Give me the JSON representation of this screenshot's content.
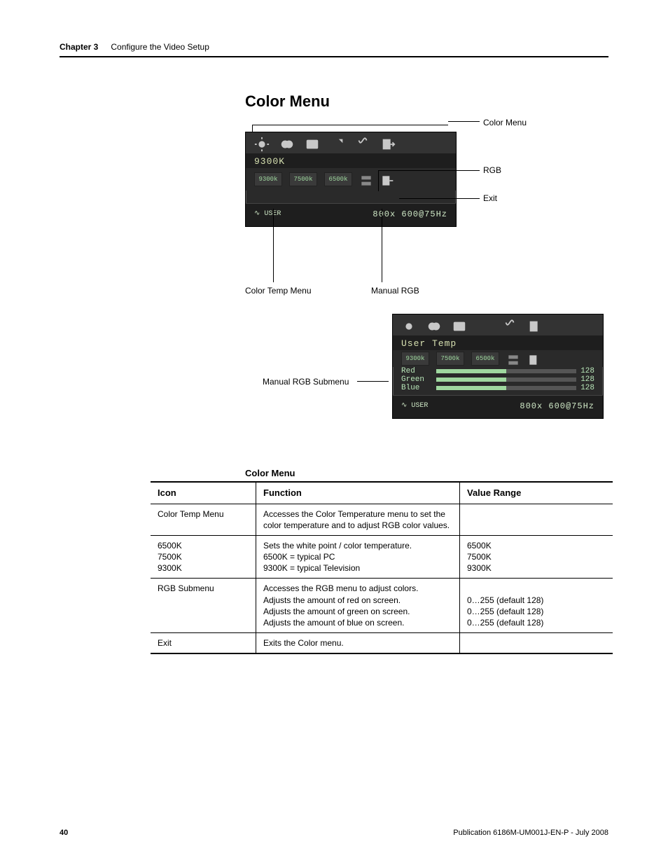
{
  "header": {
    "chapter": "Chapter 3",
    "title": "Configure the Video Setup"
  },
  "section_title": "Color Menu",
  "figure": {
    "callouts": {
      "color_menu": "Color Menu",
      "rgb": "RGB",
      "exit": "Exit",
      "color_temp_menu": "Color Temp Menu",
      "manual_rgb": "Manual RGB",
      "manual_rgb_submenu": "Manual RGB Submenu"
    },
    "osd_main": {
      "label": "9300K",
      "temps": [
        "9300k",
        "7500k",
        "6500k"
      ],
      "user_sig": "∿ USER",
      "mode_info": "800x 600@75Hz"
    },
    "osd_sub": {
      "label": "User Temp",
      "temps": [
        "9300k",
        "7500k",
        "6500k"
      ],
      "channels": [
        {
          "name": "Red",
          "value": "128"
        },
        {
          "name": "Green",
          "value": "128"
        },
        {
          "name": "Blue",
          "value": "128"
        }
      ],
      "user_sig": "∿ USER",
      "mode_info": "800x 600@75Hz"
    }
  },
  "table": {
    "title": "Color Menu",
    "headers": {
      "icon": "Icon",
      "function": "Function",
      "range": "Value Range"
    },
    "rows": [
      {
        "icon": "Color Temp Menu",
        "function": "Accesses the Color Temperature menu to set the color temperature and to adjust RGB color values.",
        "range": ""
      },
      {
        "icon": "6500K\n7500K\n9300K",
        "sub": true,
        "function": "Sets the white point / color temperature.\n6500K = typical PC\n9300K = typical Television",
        "range": "6500K\n7500K\n9300K"
      },
      {
        "icon": "RGB  Submenu",
        "function": "Accesses the RGB menu to adjust colors.\nAdjusts the amount of red on screen.\nAdjusts the amount of green on screen.\nAdjusts the amount of blue on screen.",
        "range": "\n0…255 (default 128)\n0…255 (default 128)\n0…255 (default 128)"
      },
      {
        "icon": "Exit",
        "function": "Exits the Color menu.",
        "range": ""
      }
    ]
  },
  "footer": {
    "page": "40",
    "pub": "Publication 6186M-UM001J-EN-P - July 2008"
  }
}
